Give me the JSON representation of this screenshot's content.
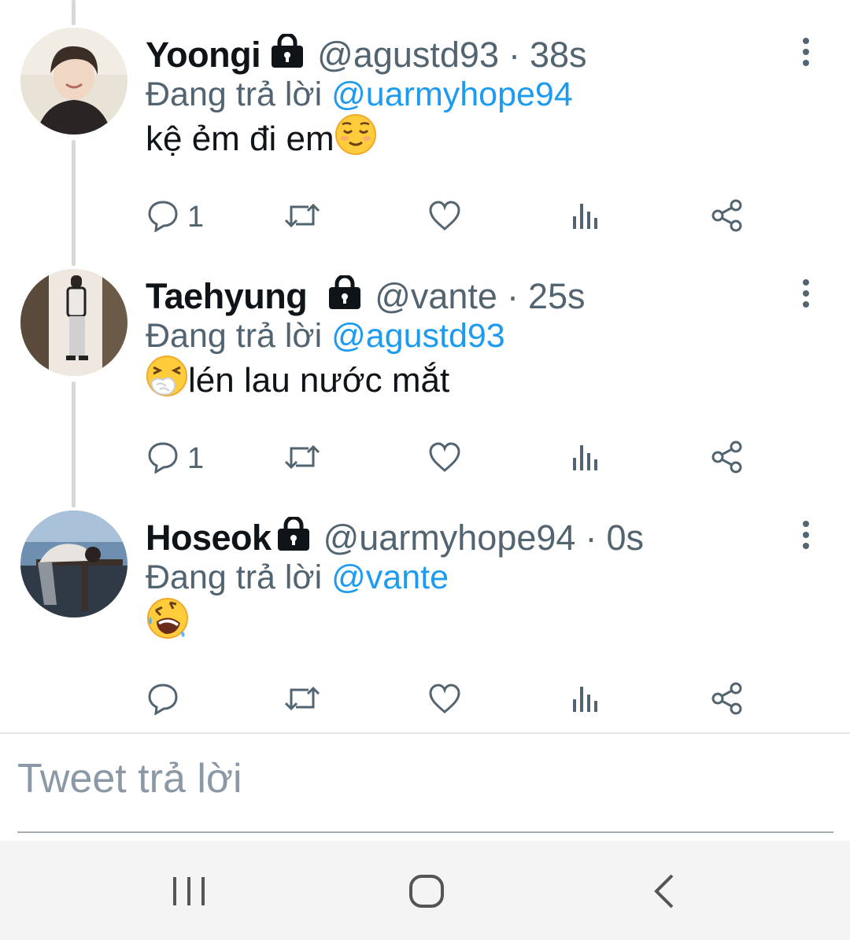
{
  "tweets": [
    {
      "name": "Yoongi",
      "handle": "@agustd93",
      "time": "38s",
      "reply_prefix": "Đang trả lời",
      "reply_to": "@uarmyhope94",
      "text": "kệ ẻm đi em",
      "emoji": "relieved-face",
      "reply_count": "1"
    },
    {
      "name": "Taehyung",
      "handle": "@vante",
      "time": "25s",
      "reply_prefix": "Đang trả lời",
      "reply_to": "@agustd93",
      "text": "lén lau nước mắt",
      "emoji": "sneezing-face",
      "reply_count": "1"
    },
    {
      "name": "Hoseok",
      "handle": "@uarmyhope94",
      "time": "0s",
      "reply_prefix": "Đang trả lời",
      "reply_to": "@vante",
      "text": "",
      "emoji": "rolling-on-floor-laughing",
      "reply_count": ""
    }
  ],
  "separator": "·",
  "compose": {
    "placeholder": "Tweet trả lời"
  },
  "colors": {
    "link": "#1d9bf0",
    "muted": "#536471",
    "text": "#0f1419",
    "thread": "#d6d9db"
  }
}
